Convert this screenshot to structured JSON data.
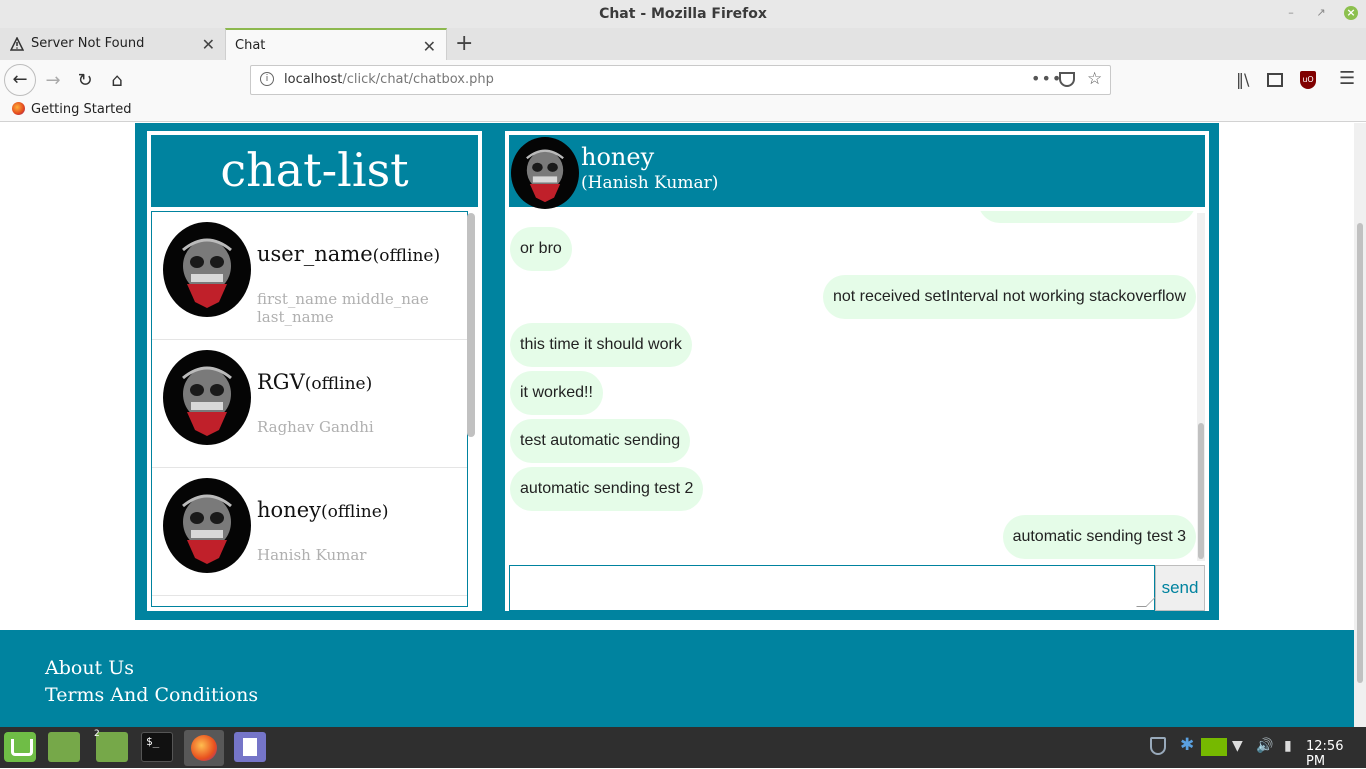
{
  "window": {
    "title": "Chat - Mozilla Firefox",
    "min_icon": "minimize-icon",
    "max_icon": "maximize-icon",
    "close_icon": "close-icon"
  },
  "tabs": [
    {
      "label": "Server Not Found",
      "active": false,
      "icon": "warning-icon"
    },
    {
      "label": "Chat",
      "active": true
    }
  ],
  "navbar": {
    "url_host": "localhost",
    "url_path": "/click/chat/chatbox.php",
    "more_glyph": "•••"
  },
  "bookmarks": [
    {
      "label": "Getting Started",
      "icon": "firefox-icon"
    }
  ],
  "chat_list": {
    "title": "chat-list",
    "users": [
      {
        "username": "user_name",
        "status": "(offline)",
        "full_name": "first_name middle_nae last_name"
      },
      {
        "username": "RGV",
        "status": "(offline)",
        "full_name": "Raghav Gandhi"
      },
      {
        "username": "honey",
        "status": "(offline)",
        "full_name": "Hanish Kumar"
      }
    ]
  },
  "chat": {
    "contact_username": "honey",
    "contact_full_name": "(Hanish Kumar)",
    "messages": [
      {
        "text": "",
        "side": "right"
      },
      {
        "text": "or bro",
        "side": "left"
      },
      {
        "text": "not received setInterval not working stackoverflow",
        "side": "right"
      },
      {
        "text": "this time it should work",
        "side": "left"
      },
      {
        "text": "it worked!!",
        "side": "left"
      },
      {
        "text": "test automatic sending",
        "side": "left"
      },
      {
        "text": "automatic sending test 2",
        "side": "left"
      },
      {
        "text": "automatic sending test 3",
        "side": "right"
      }
    ],
    "compose_value": "",
    "send_label": "send"
  },
  "footer": {
    "about": "About Us",
    "terms": "Terms And Conditions"
  },
  "taskbar": {
    "files_badge": "2",
    "terminal_glyph": "$_",
    "clock": "12:56 PM"
  },
  "colors": {
    "brand": "#00839f",
    "bubble": "#e5fce8",
    "footer_text": "#ffffff"
  }
}
